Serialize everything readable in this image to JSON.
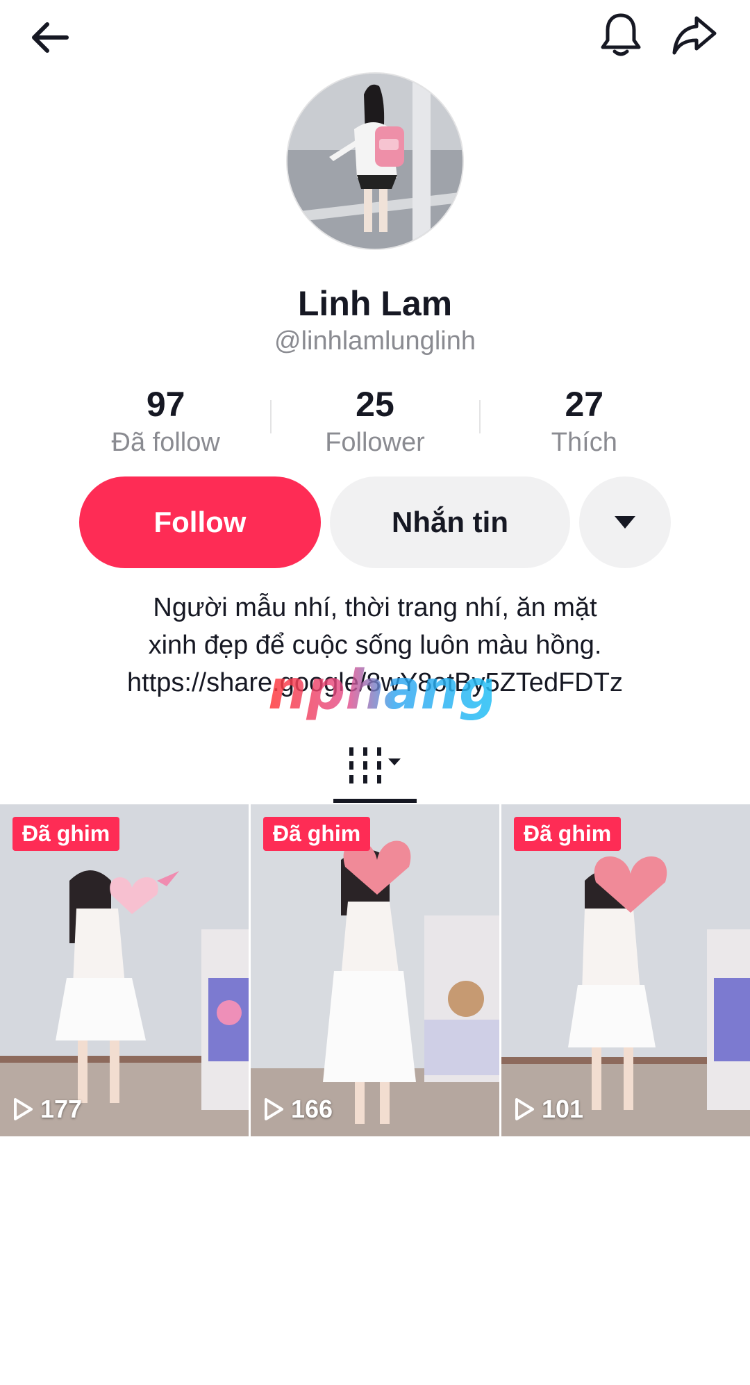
{
  "topbar": {
    "back_icon": "arrow-left-icon",
    "bell_icon": "bell-icon",
    "share_icon": "share-arrow-icon"
  },
  "profile": {
    "display_name": "Linh Lam",
    "username": "@linhlamlunglinh"
  },
  "stats": [
    {
      "value": "97",
      "label": "Đã follow"
    },
    {
      "value": "25",
      "label": "Follower"
    },
    {
      "value": "27",
      "label": "Thích"
    }
  ],
  "actions": {
    "follow_label": "Follow",
    "message_label": "Nhắn tin",
    "more_icon": "caret-down-icon"
  },
  "bio": {
    "line1": "Người mẫu nhí, thời trang nhí, ăn mặt",
    "line2": "xinh đẹp để cuộc sống luôn màu hồng.",
    "link": "https://share.google/8wY8otBy5ZTedFDTz"
  },
  "watermark": {
    "text": "nphang"
  },
  "tabs": {
    "grid_icon": "video-grid-icon"
  },
  "videos": [
    {
      "badge": "Đã ghim",
      "views": "177"
    },
    {
      "badge": "Đã ghim",
      "views": "166"
    },
    {
      "badge": "Đã ghim",
      "views": "101"
    }
  ],
  "colors": {
    "accent": "#fe2c55",
    "text": "#161823",
    "muted": "#8a8b91",
    "button_bg": "#f1f1f2"
  }
}
